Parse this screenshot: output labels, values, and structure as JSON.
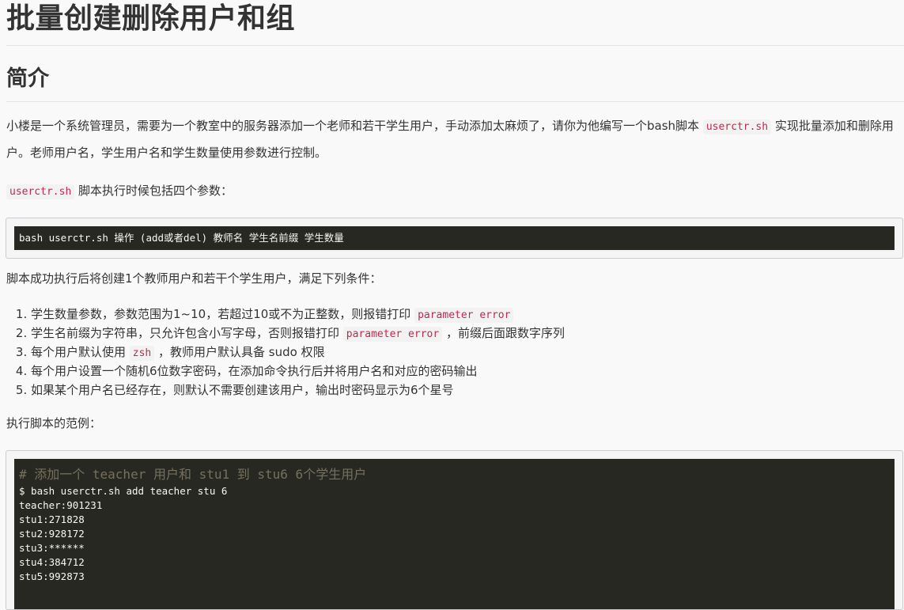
{
  "title": "批量创建删除用户和组",
  "section_heading": "简介",
  "intro": {
    "text1": "小楼是一个系统管理员，需要为一个教室中的服务器添加一个老师和若干学生用户，手动添加太麻烦了，请你为他编写一个bash脚本 ",
    "code": "userctr.sh",
    "text2": " 实现批量添加和删除用户。老师用户名，学生用户名和学生数量使用参数进行控制。"
  },
  "params_line": {
    "code": "userctr.sh",
    "text": " 脚本执行时候包括四个参数："
  },
  "usage_code": "bash userctr.sh 操作 (add或者del) 教师名 学生名前缀 学生数量",
  "conditions_intro": "脚本成功执行后将创建1个教师用户和若干个学生用户，满足下列条件：",
  "conditions": [
    {
      "before": "学生数量参数，参数范围为1~10，若超过10或不为正整数，则报错打印 ",
      "code": "parameter error",
      "after": ""
    },
    {
      "before": "学生名前缀为字符串，只允许包含小写字母，否则报错打印 ",
      "code": "parameter error",
      "after": " ，前缀后面跟数字序列"
    },
    {
      "before": "每个用户默认使用 ",
      "code": "zsh",
      "after": " ，教师用户默认具备 sudo 权限"
    },
    {
      "before": "每个用户设置一个随机6位数字密码，在添加命令执行后并将用户名和对应的密码输出",
      "code": "",
      "after": ""
    },
    {
      "before": "如果某个用户名已经存在，则默认不需要创建该用户，输出时密码显示为6个星号",
      "code": "",
      "after": ""
    }
  ],
  "example_intro": "执行脚本的范例：",
  "example_code": {
    "comment": "# 添加一个 teacher 用户和 stu1 到 stu6 6个学生用户",
    "lines": [
      "$ bash userctr.sh add teacher stu 6",
      "teacher:901231",
      "stu1:271828",
      "stu2:928172",
      "stu3:******",
      "stu4:384712",
      "stu5:992873"
    ]
  }
}
